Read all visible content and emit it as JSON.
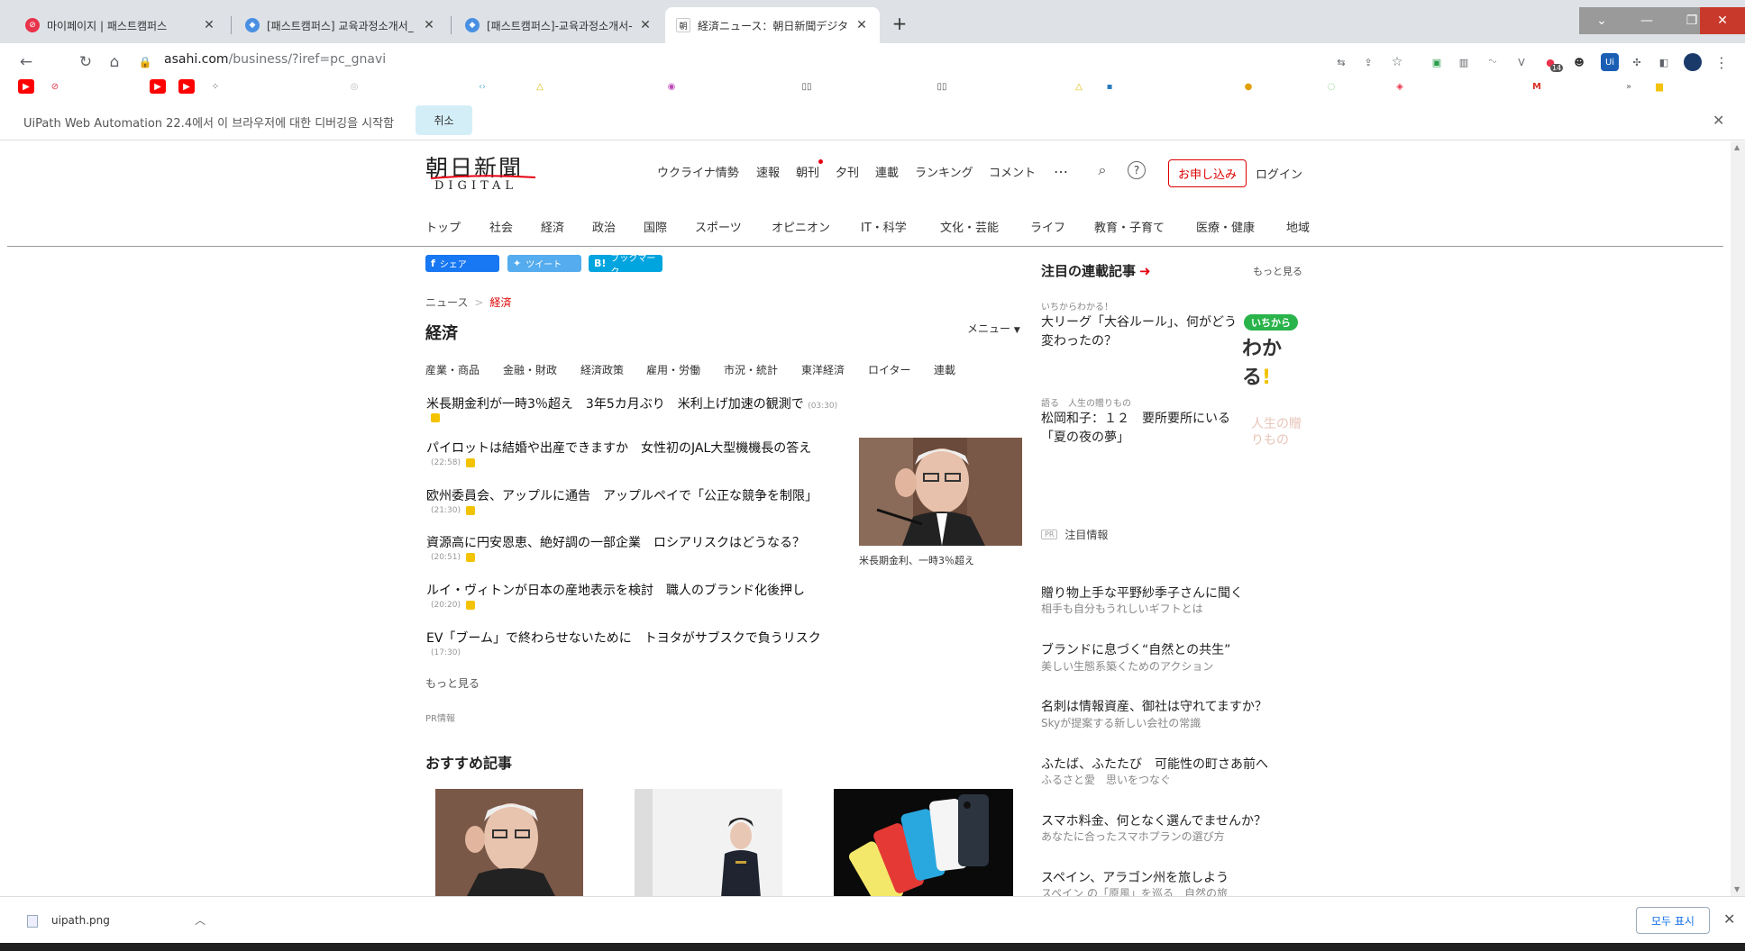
{
  "browser": {
    "tabs": [
      {
        "title": "마이페이지 | 패스트캠퍼스",
        "active": false
      },
      {
        "title": "[패스트캠퍼스] 교육과정소개서_",
        "active": false
      },
      {
        "title": "[패스트캠퍼스]-교육과정소개서-",
        "active": false
      },
      {
        "title": "経済ニュース：朝日新聞デジタル",
        "active": true
      }
    ],
    "url_host": "asahi.com",
    "url_path": "/business/?iref=pc_gnavi",
    "debug_message": "UiPath Web Automation 22.4에서 이 브라우저에 대한 디버깅을 시작함",
    "debug_cancel": "취소",
    "ext_badge": "14"
  },
  "header": {
    "logo_jp": "朝日新聞",
    "logo_en": "DIGITAL",
    "top_links": [
      "ウクライナ情勢",
      "速報",
      "朝刊",
      "夕刊",
      "連載",
      "ランキング",
      "コメント"
    ],
    "more": "…",
    "subscribe": "お申し込み",
    "login": "ログイン",
    "categories": [
      "トップ",
      "社会",
      "経済",
      "政治",
      "国際",
      "スポーツ",
      "オピニオン",
      "IT・科学",
      "文化・芸能",
      "ライフ",
      "教育・子育て",
      "医療・健康",
      "地域"
    ]
  },
  "share": {
    "facebook": "シェア",
    "twitter": "ツイート",
    "hatena": "ブックマーク"
  },
  "breadcrumb": {
    "root": "ニュース",
    "current": "経済"
  },
  "section": {
    "title": "経済",
    "menu": "メニュー",
    "subcats": [
      "産業・商品",
      "金融・財政",
      "経済政策",
      "雇用・労働",
      "市況・統計",
      "東洋経済",
      "ロイター",
      "連載"
    ],
    "articles": [
      {
        "title": "米長期金利が一時3％超え　3年5カ月ぶり　米利上げ加速の観測で",
        "time": "(03:30)"
      },
      {
        "title": "パイロットは結婚や出産できますか　女性初のJAL大型機機長の答え",
        "time": "(22:58)"
      },
      {
        "title": "欧州委員会、アップルに通告　アップルペイで「公正な競争を制限」",
        "time": "(21:30)"
      },
      {
        "title": "資源高に円安恩恵、絶好調の一部企業　ロシアリスクはどうなる？",
        "time": "(20:51)"
      },
      {
        "title": "ルイ・ヴィトンが日本の産地表示を検討　職人のブランド化後押し",
        "time": "(20:20)"
      },
      {
        "title": "EV「ブーム」で終わらせないために　トヨタがサブスクで負うリスク",
        "time": "(17:30)"
      }
    ],
    "photo_caption": "米長期金利、一時3％超え",
    "more": "もっと見る",
    "pr": "PR情報",
    "recommend": "おすすめ記事"
  },
  "right": {
    "title": "注目の連載記事",
    "more": "もっと見る",
    "items": [
      {
        "kicker": "いちからわかる！",
        "headline": "大リーグ「大谷ルール」、何がどう変わったの？"
      },
      {
        "kicker": "語る　人生の贈りもの",
        "headline": "松岡和子：１２　要所要所にいる「夏の夜の夢」"
      }
    ],
    "badge_top": "いちから",
    "badge_big": "わかる",
    "badge_mark": "!",
    "ghost_text": "人生の贈りもの",
    "attention_pr": "PR",
    "attention": "注目情報",
    "ads": [
      {
        "h": "贈り物上手な平野紗季子さんに聞く",
        "s": "相手も自分もうれしいギフトとは"
      },
      {
        "h": "ブランドに息づく“自然との共生”",
        "s": "美しい生態系築くためのアクション"
      },
      {
        "h": "名刺は情報資産、御社は守れてますか？",
        "s": "Skyが提案する新しい会社の常識"
      },
      {
        "h": "ふたば、ふたたび　可能性の町さあ前へ",
        "s": "ふるさと愛　思いをつなぐ"
      },
      {
        "h": "スマホ料金、何となく選んでませんか？",
        "s": "あなたに合ったスマホプランの選び方"
      },
      {
        "h": "スペイン、アラゴン州を旅しよう",
        "s": "スペイン の「原風」を巡る　自然の旅"
      }
    ]
  },
  "downloads": {
    "file": "uipath.png",
    "show_all": "모두 표시"
  },
  "colors": {
    "accent_red": "#e60012",
    "facebook": "#1877f2",
    "twitter": "#55acee",
    "hatena": "#00a4de",
    "wakaru_green": "#29b34a"
  }
}
